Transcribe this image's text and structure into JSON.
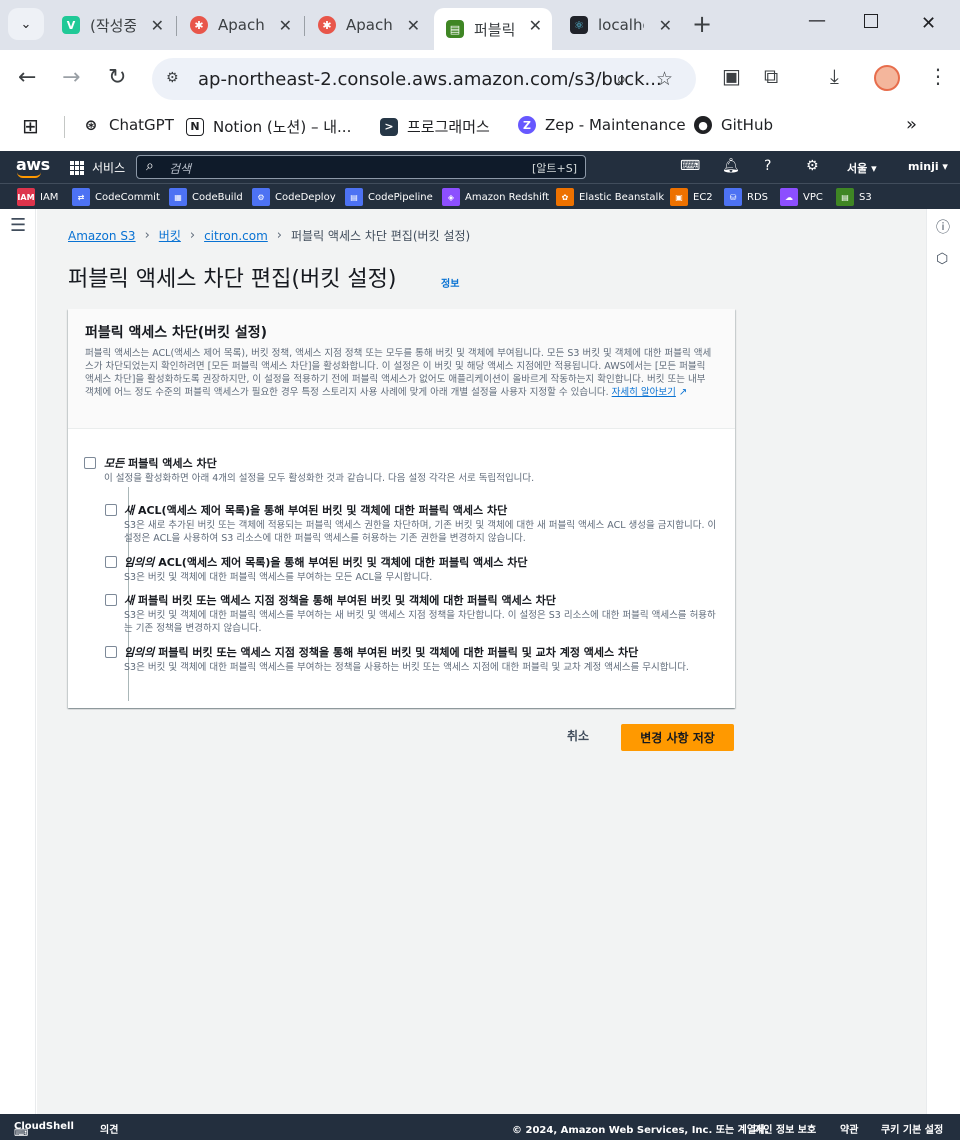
{
  "browser": {
    "tabs": [
      {
        "label": "(작성중)",
        "icon": "V",
        "color": "#20c997"
      },
      {
        "label": "Apache",
        "icon": "✱",
        "color": "#e8564a"
      },
      {
        "label": "Apache",
        "icon": "✱",
        "color": "#e8564a"
      },
      {
        "label": "퍼블릭 액세스",
        "icon": "▤",
        "color": "#3f8624"
      },
      {
        "label": "localhost",
        "icon": "⚛",
        "color": "#20232a"
      }
    ],
    "url": "ap-northeast-2.console.aws.amazon.com/s3/buck...",
    "bookmarks": [
      "ChatGPT",
      "Notion (노션) – 내...",
      "프로그래머스",
      "Zep - Maintenance",
      "GitHub"
    ]
  },
  "aws": {
    "logo": "aws",
    "services_label": "서비스",
    "search_placeholder": "검색",
    "search_shortcut": "[알트+S]",
    "region": "서울 ▾",
    "user": "minji ▾",
    "favorites": [
      {
        "label": "IAM",
        "color": "#dd344c"
      },
      {
        "label": "CodeCommit",
        "color": "#4d72f3"
      },
      {
        "label": "CodeBuild",
        "color": "#4d72f3"
      },
      {
        "label": "CodeDeploy",
        "color": "#4d72f3"
      },
      {
        "label": "CodePipeline",
        "color": "#4d72f3"
      },
      {
        "label": "Amazon Redshift",
        "color": "#8c4fff"
      },
      {
        "label": "Elastic Beanstalk",
        "color": "#ed7100"
      },
      {
        "label": "EC2",
        "color": "#ed7100"
      },
      {
        "label": "RDS",
        "color": "#4d72f3"
      },
      {
        "label": "VPC",
        "color": "#8c4fff"
      },
      {
        "label": "S3",
        "color": "#3f8624"
      }
    ]
  },
  "breadcrumb": {
    "items": [
      "Amazon S3",
      "버킷",
      "citron.com"
    ],
    "current": "퍼블릭 액세스 차단 편집(버킷 설정)"
  },
  "page": {
    "title": "퍼블릭 액세스 차단 편집(버킷 설정)",
    "info": "정보"
  },
  "panel": {
    "title": "퍼블릭 액세스 차단(버킷 설정)",
    "description": "퍼블릭 액세스는 ACL(액세스 제어 목록), 버킷 정책, 액세스 지점 정책 또는 모두를 통해 버킷 및 객체에 부여됩니다. 모든 S3 버킷 및 객체에 대한 퍼블릭 액세스가 차단되었는지 확인하려면 [모든 퍼블릭 액세스 차단]을 활성화합니다. 이 설정은 이 버킷 및 해당 액세스 지점에만 적용됩니다. AWS에서는 [모든 퍼블릭 액세스 차단]을 활성화하도록 권장하지만, 이 설정을 적용하기 전에 퍼블릭 액세스가 없어도 애플리케이션이 올바르게 작동하는지 확인합니다. 버킷 또는 내부 객체에 어느 정도 수준의 퍼블릭 액세스가 필요한 경우 특정 스토리지 사용 사례에 맞게 아래 개별 설정을 사용자 지정할 수 있습니다.",
    "learn_more": "자세히 알아보기",
    "block_all": {
      "label_em": "모든",
      "label": " 퍼블릭 액세스 차단",
      "desc": "이 설정을 활성화하면 아래 4개의 설정을 모두 활성화한 것과 같습니다. 다음 설정 각각은 서로 독립적입니다."
    },
    "options": [
      {
        "em": "새",
        "label": " ACL(액세스 제어 목록)을 통해 부여된 버킷 및 객체에 대한 퍼블릭 액세스 차단",
        "desc": "S3은 새로 추가된 버킷 또는 객체에 적용되는 퍼블릭 액세스 권한을 차단하며, 기존 버킷 및 객체에 대한 새 퍼블릭 액세스 ACL 생성을 금지합니다. 이 설정은 ACL을 사용하여 S3 리소스에 대한 퍼블릭 액세스를 허용하는 기존 권한을 변경하지 않습니다."
      },
      {
        "em": "임의의",
        "label": " ACL(액세스 제어 목록)을 통해 부여된 버킷 및 객체에 대한 퍼블릭 액세스 차단",
        "desc": "S3은 버킷 및 객체에 대한 퍼블릭 액세스를 부여하는 모든 ACL을 무시합니다."
      },
      {
        "em": "새",
        "label": " 퍼블릭 버킷 또는 액세스 지점 정책을 통해 부여된 버킷 및 객체에 대한 퍼블릭 액세스 차단",
        "desc": "S3은 버킷 및 객체에 대한 퍼블릭 액세스를 부여하는 새 버킷 및 액세스 지점 정책을 차단합니다. 이 설정은 S3 리소스에 대한 퍼블릭 액세스를 허용하는 기존 정책을 변경하지 않습니다."
      },
      {
        "em": "임의의",
        "label": " 퍼블릭 버킷 또는 액세스 지점 정책을 통해 부여된 버킷 및 객체에 대한 퍼블릭 및 교차 계정 액세스 차단",
        "desc": "S3은 버킷 및 객체에 대한 퍼블릭 액세스를 부여하는 정책을 사용하는 버킷 또는 액세스 지점에 대한 퍼블릭 및 교차 계정 액세스를 무시합니다."
      }
    ]
  },
  "actions": {
    "cancel": "취소",
    "save": "변경 사항 저장"
  },
  "footer": {
    "cloudshell": "CloudShell",
    "feedback": "의견",
    "copyright": "© 2024, Amazon Web Services, Inc. 또는 계열사.",
    "privacy": "개인 정보 보호",
    "terms": "약관",
    "cookies": "쿠키 기본 설정"
  }
}
